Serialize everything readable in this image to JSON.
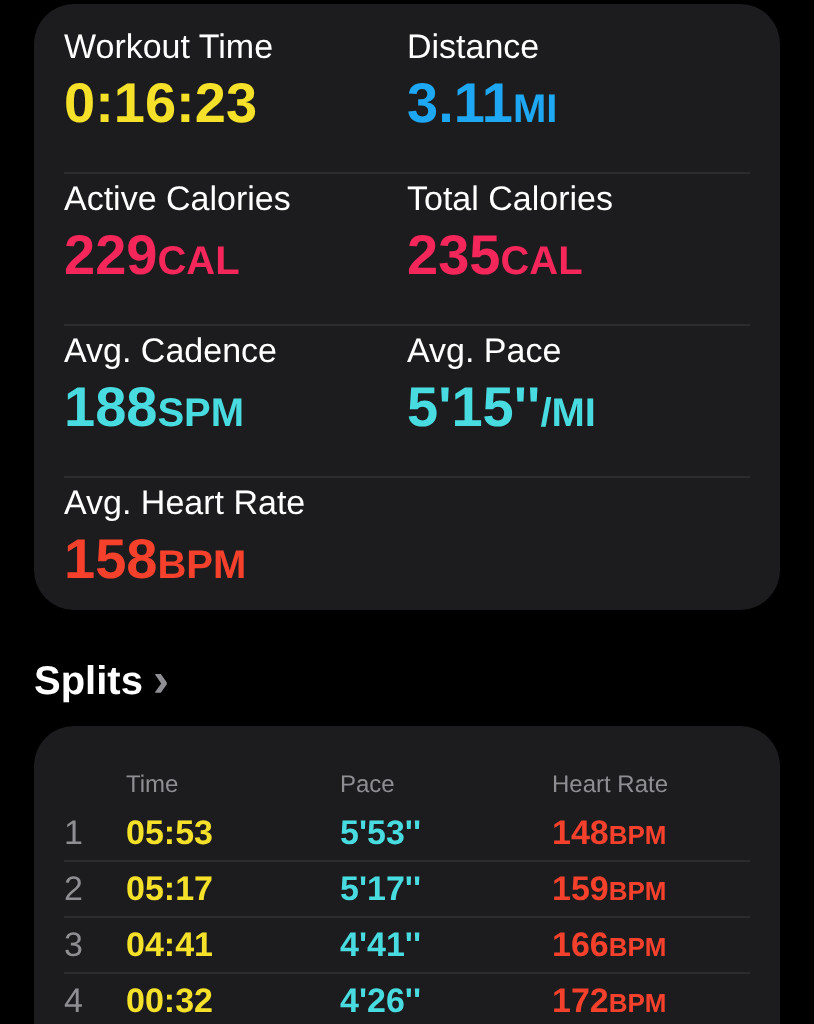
{
  "metrics": [
    {
      "label": "Workout Time",
      "value": "0:16:23",
      "color": "#f5e12a"
    },
    {
      "label": "Distance",
      "value": "3.11",
      "unit": "MI",
      "color": "#1ea7f2"
    },
    {
      "label": "Active Calories",
      "value": "229",
      "unit": "CAL",
      "color": "#f5265a"
    },
    {
      "label": "Total Calories",
      "value": "235",
      "unit": "CAL",
      "color": "#f5265a"
    },
    {
      "label": "Avg. Cadence",
      "value": "188",
      "unit": "SPM",
      "color": "#48dbe0"
    },
    {
      "label": "Avg. Pace",
      "value": "5'15''",
      "unit": "/MI",
      "color": "#48dbe0"
    },
    {
      "label": "Avg. Heart Rate",
      "value": "158",
      "unit": "BPM",
      "color": "#f5402c"
    }
  ],
  "splits": {
    "title": "Splits",
    "chevron": "›",
    "columns": [
      "Time",
      "Pace",
      "Heart Rate"
    ],
    "rows": [
      {
        "index": "1",
        "time": "05:53",
        "pace": "5'53''",
        "heart_rate": "148",
        "unit": "BPM"
      },
      {
        "index": "2",
        "time": "05:17",
        "pace": "5'17''",
        "heart_rate": "159",
        "unit": "BPM"
      },
      {
        "index": "3",
        "time": "04:41",
        "pace": "4'41''",
        "heart_rate": "166",
        "unit": "BPM"
      },
      {
        "index": "4",
        "time": "00:32",
        "pace": "4'26''",
        "heart_rate": "172",
        "unit": "BPM"
      }
    ]
  }
}
